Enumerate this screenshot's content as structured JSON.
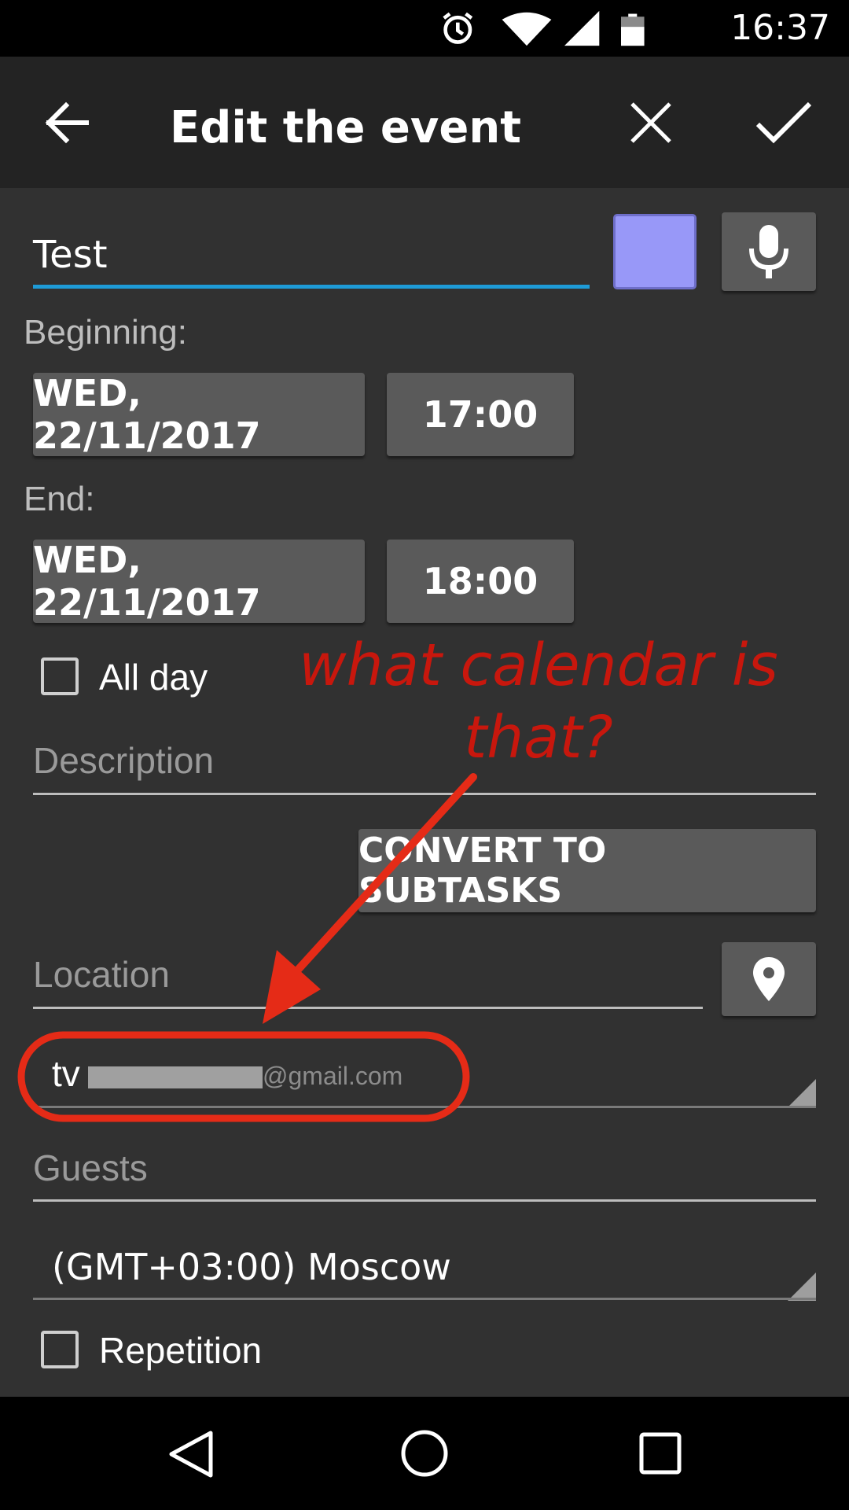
{
  "status_bar": {
    "time": "16:37",
    "icons": [
      "alarm-icon",
      "wifi-icon",
      "signal-icon",
      "battery-icon"
    ]
  },
  "app_bar": {
    "title": "Edit the event",
    "back_icon": "arrow-back-icon",
    "cancel_icon": "close-icon",
    "save_icon": "check-icon"
  },
  "form": {
    "title_value": "Test",
    "color_swatch": "#9898f8",
    "mic_icon": "microphone-icon",
    "beginning_label": "Beginning:",
    "begin_date": "WED, 22/11/2017",
    "begin_time": "17:00",
    "end_label": "End:",
    "end_date": "WED, 22/11/2017",
    "end_time": "18:00",
    "all_day_label": "All day",
    "description_placeholder": "Description",
    "convert_button": "CONVERT TO SUBTASKS",
    "location_placeholder": "Location",
    "location_icon": "map-pin-icon",
    "calendar_prefix": "tv",
    "calendar_suffix": "@gmail.com",
    "guests_placeholder": "Guests",
    "timezone_value": "(GMT+03:00) Moscow",
    "repetition_label": "Repetition"
  },
  "annotation": {
    "line1": "what calendar is",
    "line2": "that?",
    "color": "#c8170d"
  },
  "nav_bar": {
    "icons": [
      "back-triangle-icon",
      "home-circle-icon",
      "recents-square-icon"
    ]
  },
  "colors": {
    "accent_underline": "#1e9bd7",
    "background": "#313131",
    "app_bar": "#232323",
    "button": "#5a5a5a"
  }
}
